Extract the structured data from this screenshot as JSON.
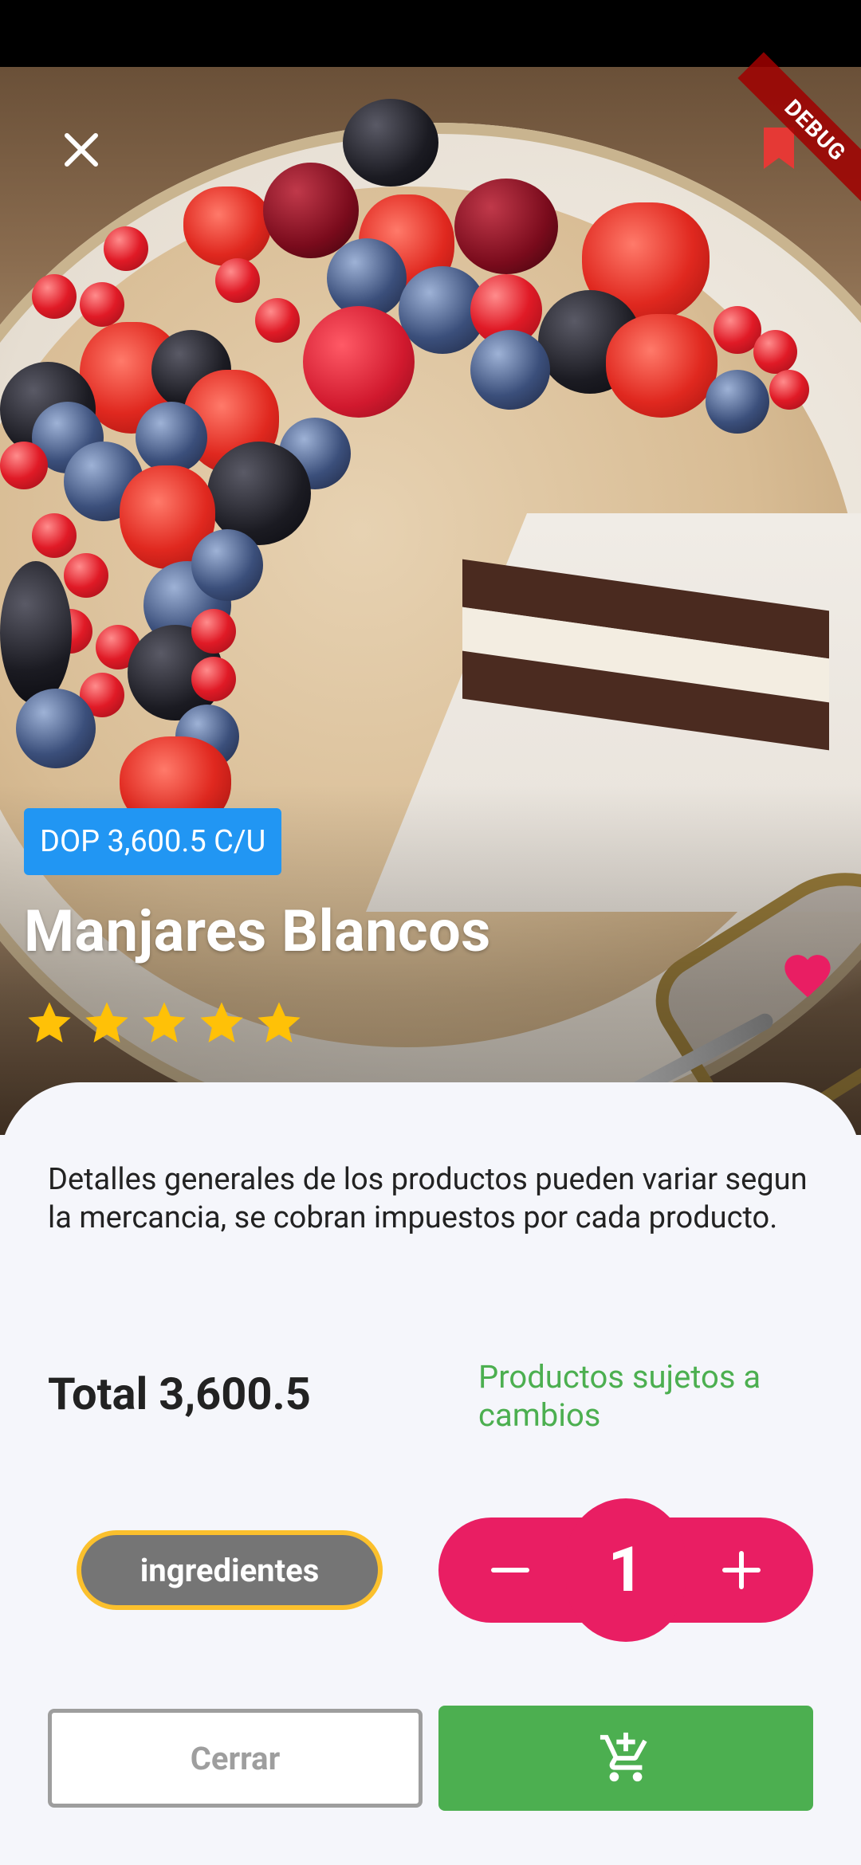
{
  "status_bar": {},
  "hero": {
    "debug_label": "DEBUG",
    "price_badge": "DOP 3,600.5 C/U",
    "title": "Manjares Blancos",
    "rating": 5,
    "rating_max": 5,
    "favorite": true
  },
  "details": {
    "description": "Detalles generales de los productos pueden variar segun la mercancia, se cobran impuestos por cada producto.",
    "total_label": "Total 3,600.5",
    "note": "Productos sujetos a cambios"
  },
  "actions": {
    "ingredients_label": "ingredientes",
    "quantity": "1",
    "close_label": "Cerrar"
  },
  "colors": {
    "primary_blue": "#2196f3",
    "accent_pink": "#e91e63",
    "success_green": "#4caf50",
    "ingredients_gray": "#757575",
    "ingredients_border": "#fbc02d",
    "star_gold": "#ffc107"
  },
  "icons": {
    "close": "close-icon",
    "bookmark": "bookmark-icon",
    "star": "star-icon",
    "heart": "heart-icon",
    "minus": "minus-icon",
    "plus": "plus-icon",
    "cart": "add-shopping-cart-icon"
  }
}
